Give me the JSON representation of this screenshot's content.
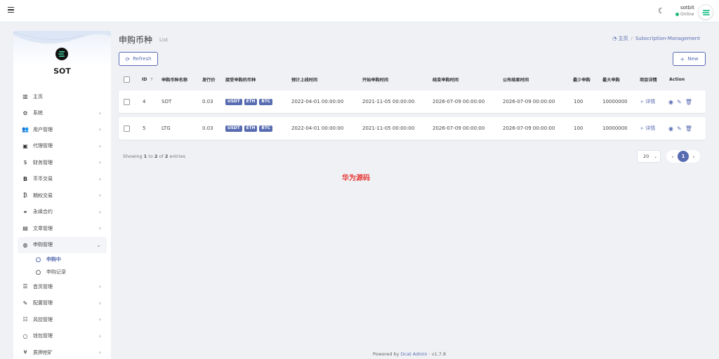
{
  "navbar": {
    "username": "sotbit",
    "status": "Online",
    "status_color": "#21b978"
  },
  "brand": {
    "name": "SOT"
  },
  "sidebar": {
    "items": [
      {
        "icon": "bar-chart-icon",
        "glyph": "📊",
        "label": "主页",
        "has_children": false
      },
      {
        "icon": "gear-icon",
        "glyph": "⚙",
        "label": "系统",
        "has_children": true
      },
      {
        "icon": "users-icon",
        "glyph": "👥",
        "label": "用户管理",
        "has_children": true
      },
      {
        "icon": "id-card-icon",
        "glyph": "🪪",
        "label": "代理管理",
        "has_children": true
      },
      {
        "icon": "dollar-icon",
        "glyph": "$",
        "label": "财务管理",
        "has_children": true
      },
      {
        "icon": "bitcoin-bold-icon",
        "glyph": "B",
        "label": "币币交易",
        "has_children": true
      },
      {
        "icon": "bitcoin-icon",
        "glyph": "₿",
        "label": "期权交易",
        "has_children": true
      },
      {
        "icon": "link-icon",
        "glyph": "🔗",
        "label": "永续合约",
        "has_children": true
      },
      {
        "icon": "newspaper-icon",
        "glyph": "📰",
        "label": "文章管理",
        "has_children": true
      },
      {
        "icon": "globe-icon",
        "glyph": "🌐",
        "label": "申购管理",
        "has_children": true,
        "open": true
      }
    ],
    "sub_items": [
      {
        "label": "申购中",
        "active": true
      },
      {
        "label": "申购记录",
        "active": false
      }
    ],
    "items_after": [
      {
        "icon": "list-icon",
        "glyph": "☰",
        "label": "首页管理",
        "has_children": true
      },
      {
        "icon": "wrench-icon",
        "glyph": "🔧",
        "label": "配置管理",
        "has_children": true
      },
      {
        "icon": "indent-icon",
        "glyph": "☷",
        "label": "风控管理",
        "has_children": true
      },
      {
        "icon": "circle-icon",
        "glyph": "○",
        "label": "钱包管理",
        "has_children": true
      },
      {
        "icon": "yen-icon",
        "glyph": "¥",
        "label": "质押挖矿",
        "has_children": true
      }
    ]
  },
  "header": {
    "title": "申购币种",
    "subtitle": "List",
    "breadcrumb": {
      "home": "主页",
      "current": "Subscription-Management"
    }
  },
  "toolbar": {
    "refresh_label": "Refresh",
    "new_label": "New"
  },
  "table": {
    "columns": [
      "ID",
      "申购币种名称",
      "发行价",
      "接受申购的币种",
      "预计上线时间",
      "开始申购时间",
      "结束申购时间",
      "公布结果时间",
      "最少申购",
      "最大申购",
      "项目详情",
      "Action"
    ],
    "rows": [
      {
        "id": "4",
        "name": "SOT",
        "price": "0.03",
        "currencies": [
          "USDT",
          "ETH",
          "BTC"
        ],
        "launch": "2022-04-01 00:00:00",
        "start": "2021-11-05 00:00:00",
        "end": "2026-07-09 00:00:00",
        "announce": "2026-07-09 00:00:00",
        "min": "100",
        "max": "10000000",
        "detail": "详情"
      },
      {
        "id": "5",
        "name": "LTG",
        "price": "0.03",
        "currencies": [
          "USDT",
          "ETH",
          "BTC"
        ],
        "launch": "2022-04-01 00:00:00",
        "start": "2021-11-05 00:00:00",
        "end": "2026-07-09 00:00:00",
        "announce": "2026-07-09 00:00:00",
        "min": "100",
        "max": "10000000",
        "detail": "详情"
      }
    ]
  },
  "pagination": {
    "showing_prefix": "Showing",
    "from": "1",
    "to_word": "to",
    "to": "2",
    "of_word": "of",
    "total": "2",
    "suffix": "entries",
    "per_page": "20",
    "current_page": "1"
  },
  "watermark": "华为源码",
  "footer": {
    "powered_by": "Powered by",
    "product": "Dcat Admin",
    "separator": "·",
    "version": "v1.7.8"
  },
  "colors": {
    "accent": "#586cb1",
    "watermark": "#e53935"
  }
}
